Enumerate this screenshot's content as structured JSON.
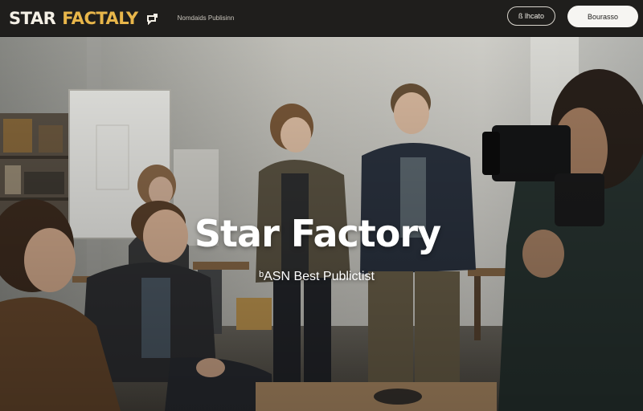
{
  "header": {
    "logo_main": "STAR",
    "logo_accent": "FACTALY",
    "tagline": "Nomdaids Publisinn",
    "outline_button_label": "ß lhcato",
    "solid_button_label": "Bourasso"
  },
  "hero": {
    "title": "Star Factory",
    "subtitle": "ᵇASN Best Publictist"
  },
  "colors": {
    "navbar_bg": "#1f1e1c",
    "logo_accent": "#e8b64a",
    "solid_button_bg": "#f6f5f2",
    "hero_text": "#ffffff"
  },
  "icons": {
    "logo_mark": "chat-bubble-icon"
  }
}
